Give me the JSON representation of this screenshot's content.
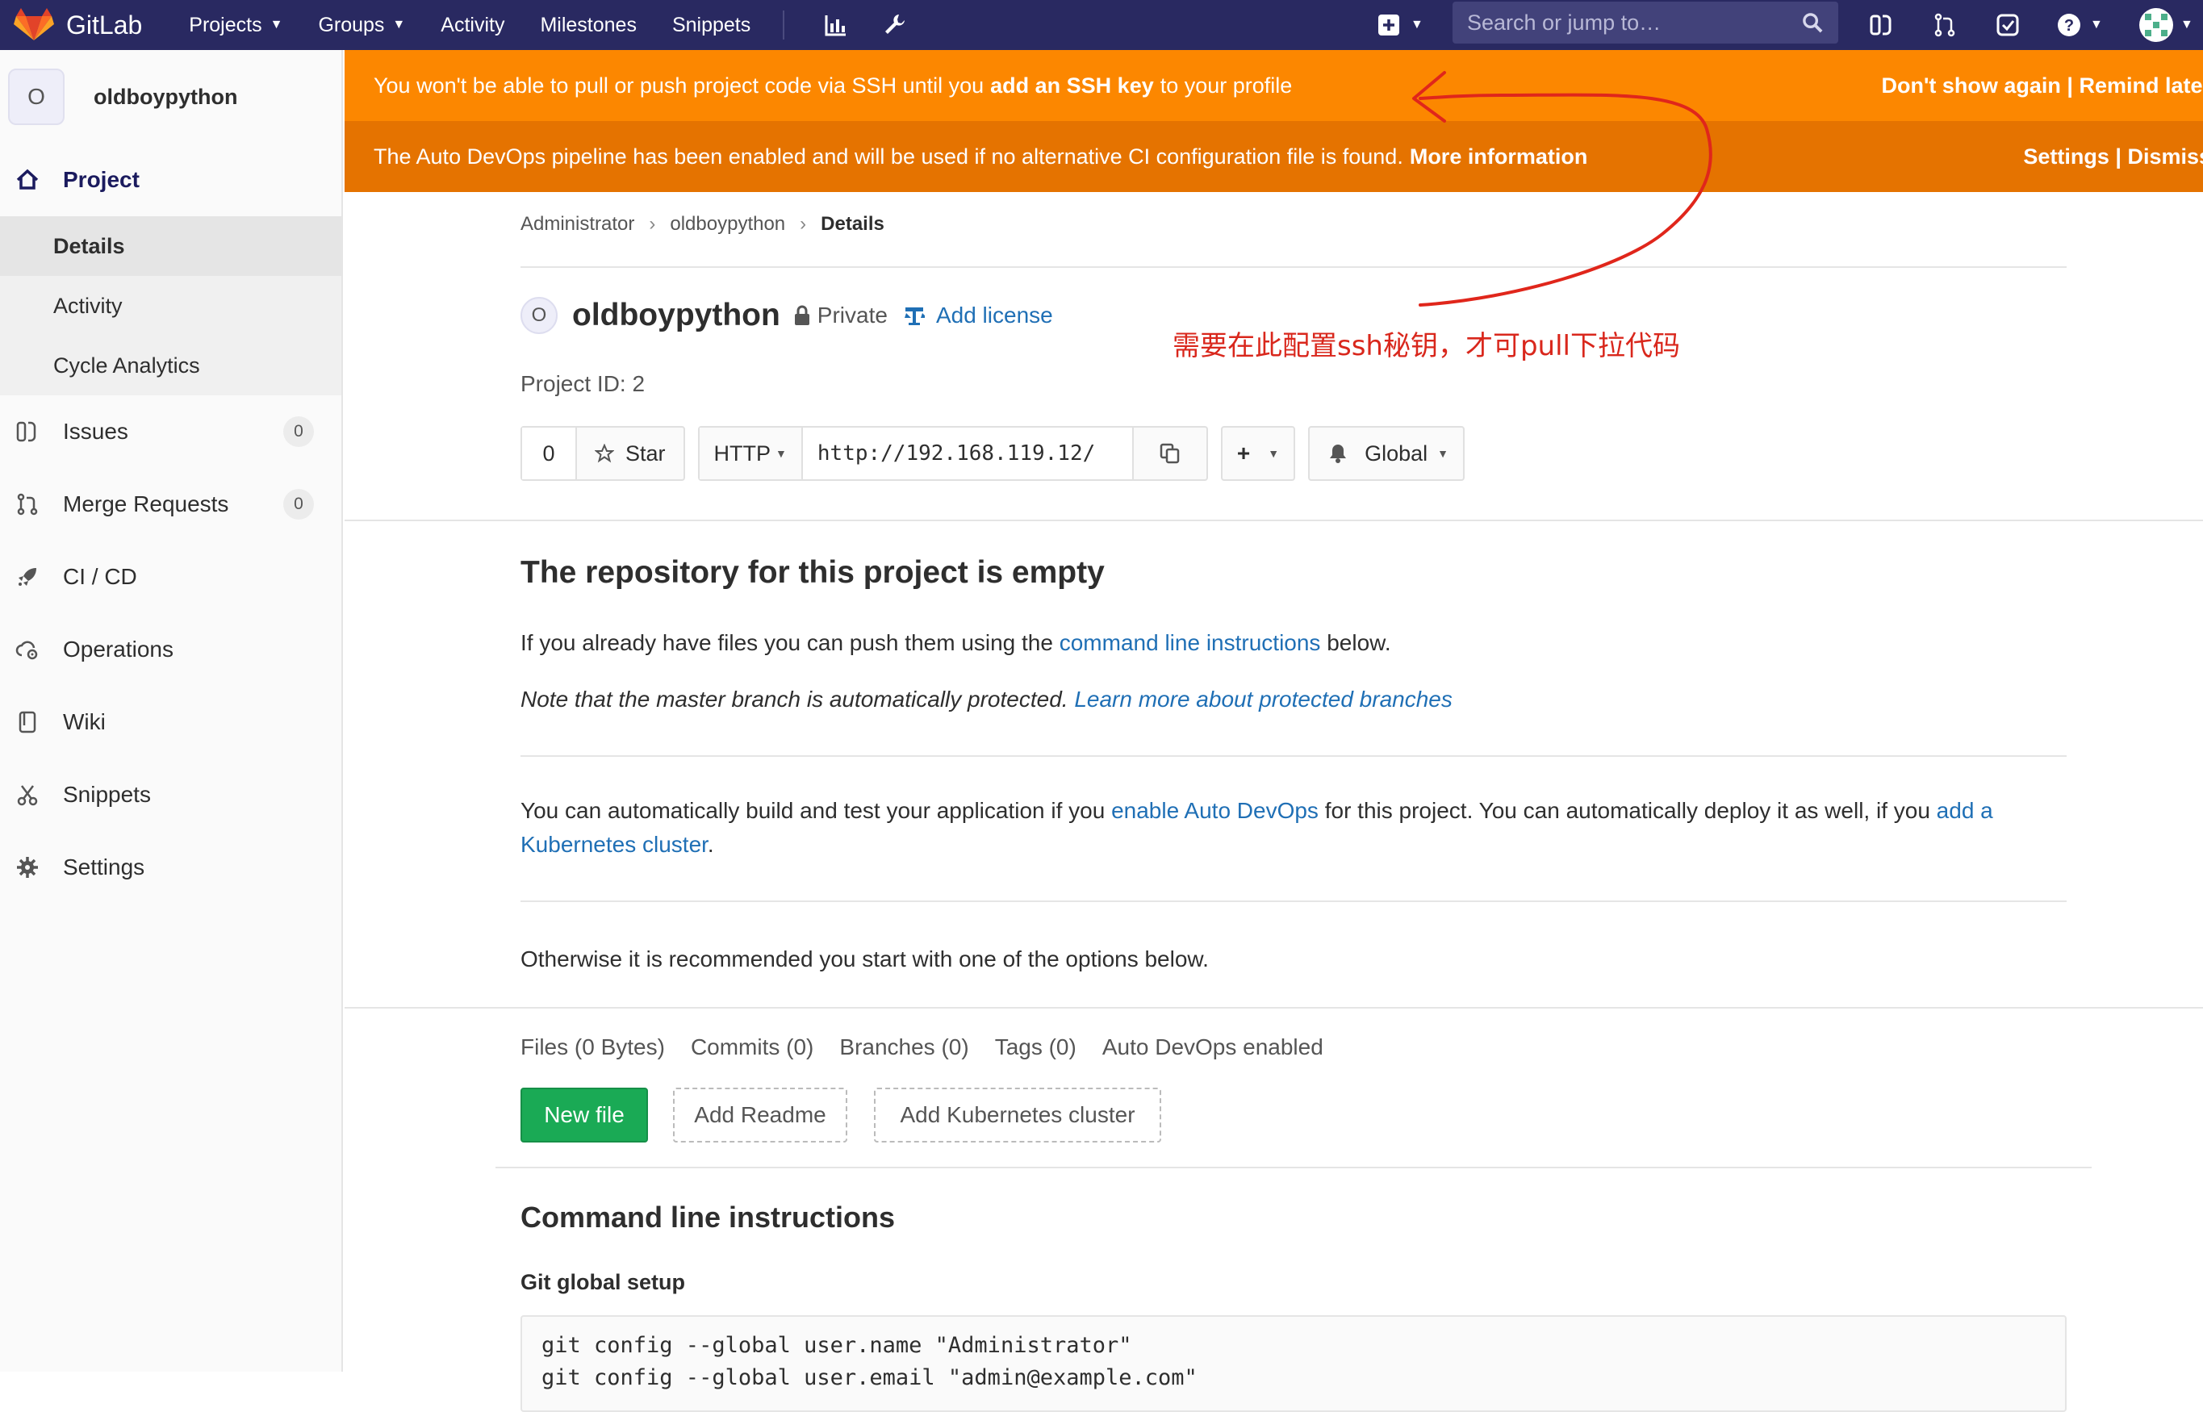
{
  "navbar": {
    "brand": "GitLab",
    "links": {
      "projects": "Projects",
      "groups": "Groups",
      "activity": "Activity",
      "milestones": "Milestones",
      "snippets": "Snippets"
    },
    "search_placeholder": "Search or jump to…"
  },
  "sidebar": {
    "avatar_letter": "O",
    "project_name": "oldboypython",
    "project_label": "Project",
    "sub": {
      "details": "Details",
      "activity": "Activity",
      "cycle": "Cycle Analytics"
    },
    "issues": "Issues",
    "issues_count": "0",
    "merge_requests": "Merge Requests",
    "mr_count": "0",
    "cicd": "CI / CD",
    "operations": "Operations",
    "wiki": "Wiki",
    "snippets": "Snippets",
    "settings": "Settings"
  },
  "alerts": {
    "ssh_pre": "You won't be able to pull or push project code via SSH until you ",
    "ssh_bold": "add an SSH key",
    "ssh_post": " to your profile",
    "ssh_actions": "Don't show again | Remind later",
    "autodevops_text": "The Auto DevOps pipeline has been enabled and will be used if no alternative CI configuration file is found. ",
    "autodevops_link": "More information",
    "autodevops_actions": "Settings | Dismiss"
  },
  "breadcrumb": {
    "admin": "Administrator",
    "project": "oldboypython",
    "current": "Details",
    "sep": "›"
  },
  "project": {
    "avatar_letter": "O",
    "title": "oldboypython",
    "visibility": "Private",
    "add_license": "Add license",
    "project_id": "Project ID: 2",
    "star_count": "0",
    "star_label": "Star",
    "protocol": "HTTP",
    "clone_url": "http://192.168.119.12/",
    "notification": "Global"
  },
  "annotation": "需要在此配置ssh秘钥，才可pull下拉代码",
  "empty": {
    "title": "The repository for this project is empty",
    "push_pre": "If you already have files you can push them using the ",
    "push_link": "command line instructions",
    "push_post": " below.",
    "note_pre": "Note that the master branch is automatically protected. ",
    "note_link": "Learn more about protected branches",
    "auto_pre": "You can automatically build and test your application if you ",
    "auto_link": "enable Auto DevOps",
    "auto_mid": " for this project. You can automatically deploy it as well, if you ",
    "auto_link2a": "add a",
    "auto_link2b": "Kubernetes cluster",
    "auto_post": ".",
    "otherwise": "Otherwise it is recommended you start with one of the options below."
  },
  "tabs": {
    "files": "Files (0 Bytes)",
    "commits": "Commits (0)",
    "branches": "Branches (0)",
    "tags": "Tags (0)",
    "autodevops": "Auto DevOps enabled"
  },
  "actions": {
    "new_file": "New file",
    "add_readme": "Add Readme",
    "add_k8s": "Add Kubernetes cluster"
  },
  "cli": {
    "title": "Command line instructions",
    "git_setup": "Git global setup",
    "line1": "git config --global user.name \"Administrator\"",
    "line2": "git config --global user.email \"admin@example.com\""
  },
  "colors": {
    "navbar": "#292961",
    "alert_ssh": "#fc8700",
    "alert_autodevops": "#e57300",
    "link": "#1f6fb5",
    "new_file_green": "#1aaa55",
    "annotation_red": "#d9271c"
  }
}
